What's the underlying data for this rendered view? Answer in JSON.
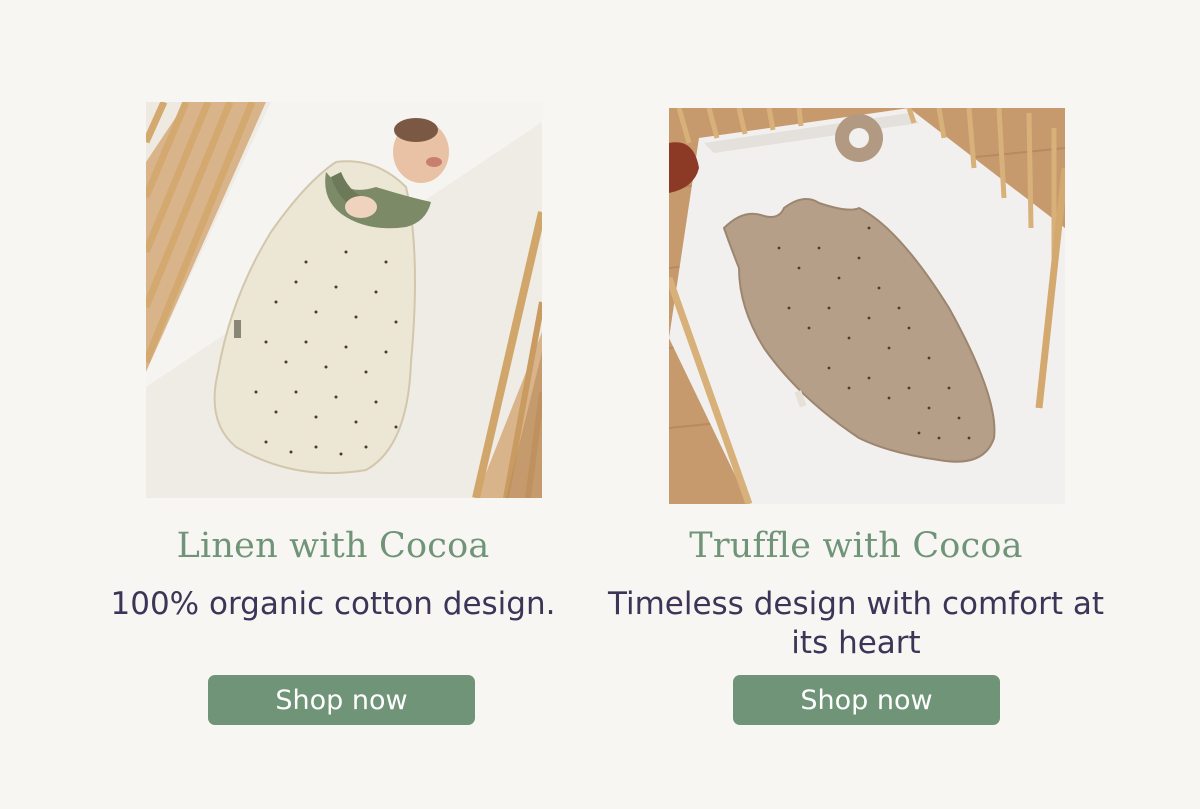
{
  "products": [
    {
      "title": "Linen with Cocoa",
      "description": "100% organic cotton design.",
      "button_label": "Shop now",
      "sack_color": "#ece6d4",
      "dot_color": "#4a3b2d"
    },
    {
      "title": "Truffle with Cocoa",
      "description": "Timeless design with comfort at its heart",
      "button_label": "Shop now",
      "sack_color": "#b59f88",
      "dot_color": "#4a3b2d"
    }
  ],
  "colors": {
    "background": "#f8f6f3",
    "accent": "#6f9478",
    "text": "#3d3557"
  }
}
